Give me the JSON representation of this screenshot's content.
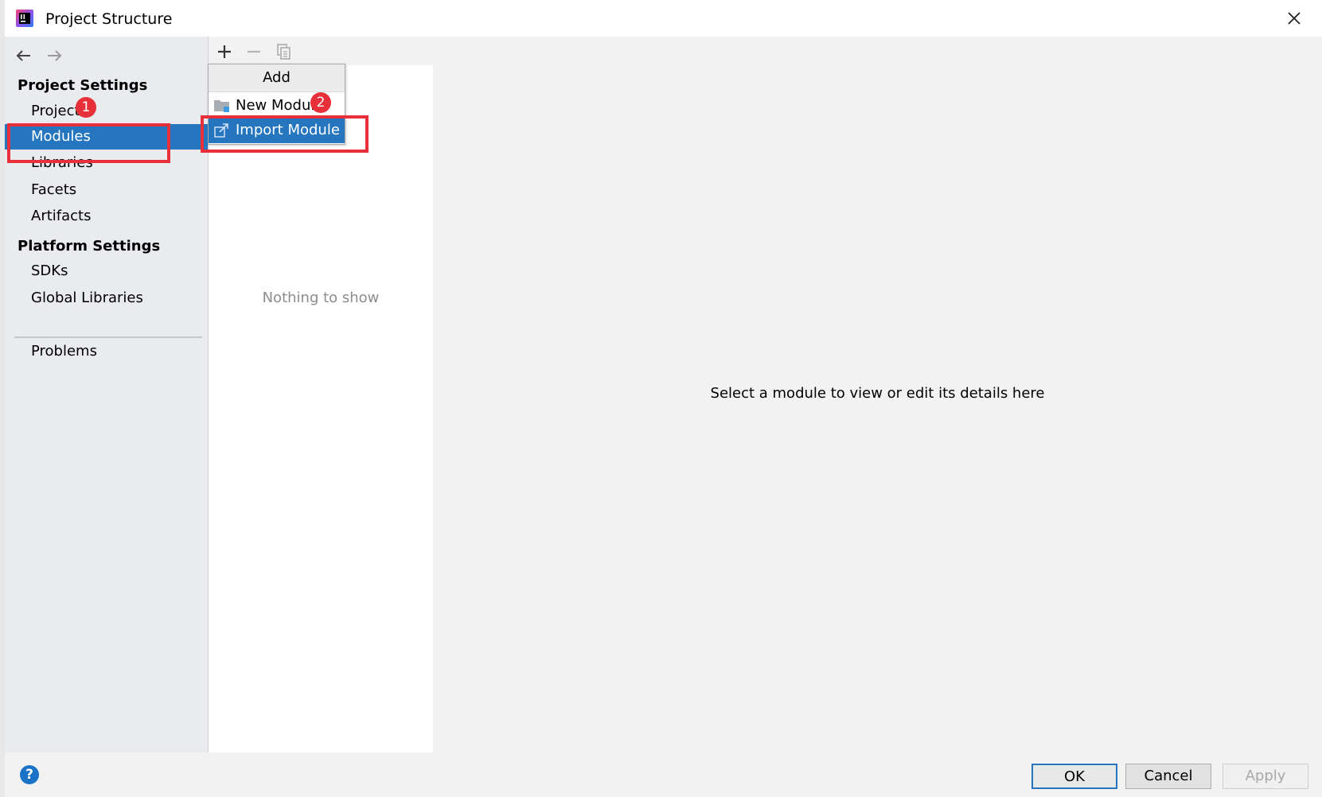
{
  "window": {
    "title": "Project Structure",
    "icons": {
      "app": "intellij-icon",
      "close": "close-icon"
    }
  },
  "nav": {
    "toolbar": {
      "back": "arrow-left-icon",
      "forward": "arrow-right-icon"
    },
    "project_settings_heading": "Project Settings",
    "project_settings_items": [
      {
        "label": "Project"
      },
      {
        "label": "Modules",
        "selected": true
      },
      {
        "label": "Libraries"
      },
      {
        "label": "Facets"
      },
      {
        "label": "Artifacts"
      }
    ],
    "platform_settings_heading": "Platform Settings",
    "platform_settings_items": [
      {
        "label": "SDKs"
      },
      {
        "label": "Global Libraries"
      }
    ],
    "problems_label": "Problems"
  },
  "modules_panel": {
    "toolbar": {
      "add": "plus-icon",
      "remove": "minus-icon",
      "copy": "copy-icon"
    },
    "empty_text": "Nothing to show"
  },
  "add_popup": {
    "header": "Add",
    "items": [
      {
        "label": "New Module",
        "icon": "folder-module-icon"
      },
      {
        "label": "Import Module",
        "icon": "import-module-icon",
        "highlighted": true
      }
    ]
  },
  "details": {
    "placeholder": "Select a module to view or edit its details here"
  },
  "footer": {
    "help": "?",
    "ok_label": "OK",
    "cancel_label": "Cancel",
    "apply_label": "Apply"
  },
  "annotations": {
    "step1": "1",
    "step2": "2",
    "color": "#e8303a"
  },
  "colors": {
    "selection": "#2675bf",
    "nav_bg": "#e9ebee"
  }
}
